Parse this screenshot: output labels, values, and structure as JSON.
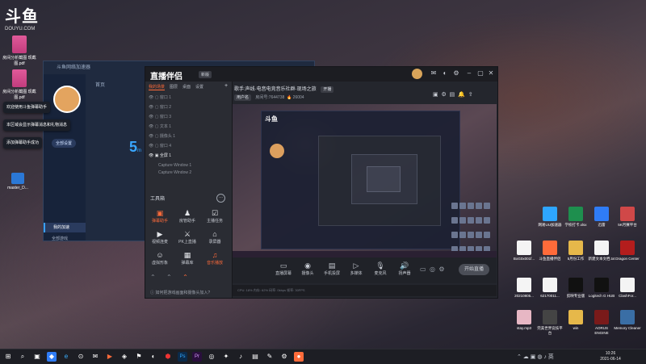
{
  "desktop_left": {
    "logo_main": "斗鱼",
    "logo_sub": "DOUYU.COM",
    "icons": [
      {
        "label": "房间分析截图 现截图.pdf",
        "kind": "pdf"
      },
      {
        "label": "房间分析截图 现截图.pdf",
        "kind": "pdf"
      },
      {
        "label": "master_D...",
        "kind": "win"
      }
    ]
  },
  "helper_window": {
    "title": "斗鱼网络加速器",
    "section": "首页",
    "number": "5",
    "number_suffix": "m",
    "pill": "全部设置",
    "menu_active": "我的加速",
    "menu_other": "全部游戏",
    "tips": [
      "欢迎使用斗鱼弹幕助手",
      "本区域会显示弹幕消息和礼物消息",
      "添加弹幕助手成功"
    ]
  },
  "app": {
    "brand": "直播伴侣",
    "version": "新版",
    "source_tabs": [
      "我的场景",
      "图层",
      "桌面",
      "设置"
    ],
    "scenes": [
      "窗口 1",
      "窗口 2",
      "窗口 3",
      "文本 1",
      "摄像头 1",
      "窗口 4",
      "全屏 1",
      "Capture Window 1",
      "Capture Window 2"
    ],
    "tools_title": "工具箱",
    "tools": [
      {
        "label": "弹幕助手",
        "icon": "▣",
        "active": true
      },
      {
        "label": "房管助手",
        "icon": "♟",
        "active": false
      },
      {
        "label": "主播任务",
        "icon": "☑",
        "active": false
      },
      {
        "label": "视频连麦",
        "icon": "▶",
        "active": false
      },
      {
        "label": "PK上直播",
        "icon": "⚔",
        "active": false
      },
      {
        "label": "录屏器",
        "icon": "⌂",
        "active": false
      },
      {
        "label": "虚拟形象",
        "icon": "☺",
        "active": false
      },
      {
        "label": "弹幕库",
        "icon": "▦",
        "active": false
      },
      {
        "label": "音乐播放",
        "icon": "♫",
        "active": true
      }
    ],
    "hint": "如何把游戏画面和摄像头加入?",
    "live_title": "歌手:声线·电音电竞音乐社群·现场之旅",
    "live_tag": "开播",
    "room_pill": "用户名",
    "room_id": "房间号:7644738",
    "room_hot": "26004",
    "bottom_buttons": [
      {
        "label": "直播屏幕",
        "icon": "▭"
      },
      {
        "label": "摄像头",
        "icon": "◉"
      },
      {
        "label": "手机投屏",
        "icon": "▤"
      },
      {
        "label": "多媒体",
        "icon": "▷"
      },
      {
        "label": "麦克风",
        "icon": "🎙"
      },
      {
        "label": "扬声器",
        "icon": "🔊"
      }
    ],
    "start_button": "开始直播",
    "status": "CPU: 18% 内存: 62% 码率: 0kbps 帧率: 30FPS"
  },
  "desktop_right": {
    "icons": [
      {
        "label": "网易UU加速器",
        "color": "#2ea6ff"
      },
      {
        "label": "学校打卡.xlsx",
        "color": "#1e8f4e"
      },
      {
        "label": "迅雷",
        "color": "#2f7cf6"
      },
      {
        "label": "5K月赛平台",
        "color": "#d04848"
      },
      {
        "label": "BoG0x001f...",
        "color": "#f4f4f4"
      },
      {
        "label": "斗鱼直播伴侣",
        "color": "#ff6b3a"
      },
      {
        "label": "5月份工作",
        "color": "#e6b84a"
      },
      {
        "label": "新建文本文档.txt",
        "color": "#f4f4f4"
      },
      {
        "label": "Dragon Center",
        "color": "#b31d1d"
      },
      {
        "label": "20210805...",
        "color": "#f4f4f4"
      },
      {
        "label": "62170011...",
        "color": "#f4f4f4"
      },
      {
        "label": "剪映专业版",
        "color": "#111111"
      },
      {
        "label": "Logitech G HUB",
        "color": "#111111"
      },
      {
        "label": "ClashFor...",
        "color": "#f4f4f4"
      },
      {
        "label": "stay.mp3",
        "color": "#e7b7c4"
      },
      {
        "label": "完美世界竞技平台",
        "color": "#444444"
      },
      {
        "label": "win",
        "color": "#e6b84a"
      },
      {
        "label": "AORUS ENGINE",
        "color": "#7a1a1a"
      },
      {
        "label": "Memory Cleaner",
        "color": "#3a6ea5"
      }
    ]
  },
  "taskbar": {
    "time": "10:26",
    "date": "2021-06-14",
    "icons": [
      "⊞",
      "⌕",
      "▣",
      "◆",
      "e",
      "⊙",
      "✉",
      "▶",
      "◈",
      "⚑",
      "◐",
      "⬢",
      "Ps",
      "Pr",
      "◎",
      "✦",
      "♪",
      "▤",
      "✎",
      "⚙",
      "●"
    ]
  }
}
